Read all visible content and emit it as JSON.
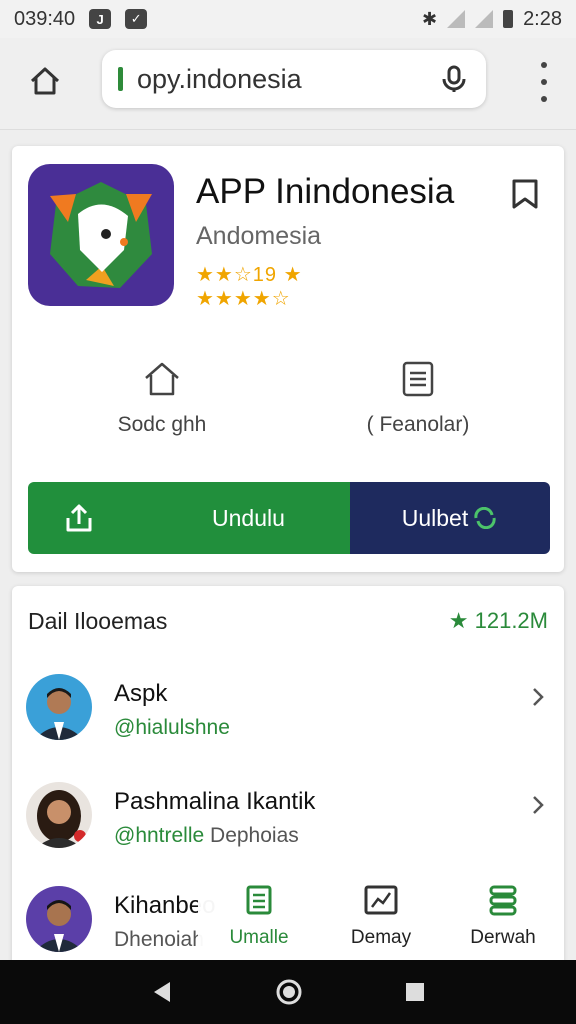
{
  "status_bar": {
    "time_left": "039:40",
    "time_right": "2:28"
  },
  "browser": {
    "url": "opy.indonesia"
  },
  "app": {
    "title": "APP Inindonesia",
    "subtitle": "Andomesia",
    "rating_top": "★★☆19 ★",
    "rating_bottom": "★★★★☆",
    "icon_bg": "#4a2f96"
  },
  "actions": [
    {
      "label": "Sodc ghh",
      "icon": "home-outline-icon"
    },
    {
      "label": "( Feanolar)",
      "icon": "document-icon"
    }
  ],
  "buttons": {
    "download_label": "Undulu",
    "secondary_label": "Uulbet",
    "green": "#218f3c",
    "navy": "#1e2a5e"
  },
  "list": {
    "header": "Dail Ilooemas",
    "count": "★ 121.2M",
    "people": [
      {
        "name": "Aspk",
        "handle_at": "@hialulshne",
        "handle_rest": ""
      },
      {
        "name": "Pashmalina Ikantik",
        "handle_at": "@hntrelle",
        "handle_rest": " Dephoias"
      },
      {
        "name": "Kihanbeo",
        "handle_at": "",
        "handle_rest": "Dhenoiah"
      }
    ]
  },
  "bottom_nav": [
    {
      "label": "Umalle",
      "icon": "list-icon",
      "active": true
    },
    {
      "label": "Demay",
      "icon": "chart-icon",
      "active": false
    },
    {
      "label": "Derwah",
      "icon": "stack-icon",
      "active": false
    }
  ]
}
